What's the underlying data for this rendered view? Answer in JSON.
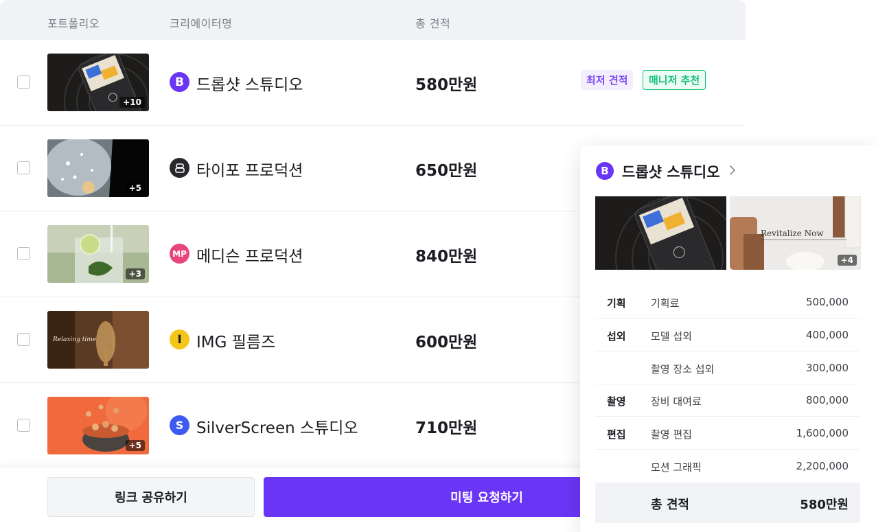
{
  "table": {
    "headers": {
      "portfolio": "포트폴리오",
      "creator": "크리에이터명",
      "total": "총 견적"
    },
    "rows": [
      {
        "creator": "드롭샷 스튜디오",
        "logo_text": "B",
        "logo_color": "#6a35f5",
        "price": "580만원",
        "thumb_count": "+10",
        "tags": {
          "lowest": "최저 견적",
          "recommend": "매니저 추천"
        }
      },
      {
        "creator": "타이포 프로덕션",
        "logo_text": "",
        "logo_color": "#26282c",
        "price": "650만원",
        "thumb_count": "+5"
      },
      {
        "creator": "메디슨 프로덕션",
        "logo_text": "MP",
        "logo_color": "#e8457c",
        "price": "840만원",
        "thumb_count": "+3"
      },
      {
        "creator": "IMG 필름즈",
        "logo_text": "I",
        "logo_color": "#f5c518",
        "price": "600만원",
        "thumb_count": "",
        "thumb_text": "Relaxing time"
      },
      {
        "creator": "SilverScreen 스튜디오",
        "logo_text": "S",
        "logo_color": "#3d5af1",
        "price": "710만원",
        "thumb_count": "+5"
      }
    ]
  },
  "actions": {
    "share_label": "링크 공유하기",
    "meeting_label": "미팅 요청하기"
  },
  "detail": {
    "logo_text": "B",
    "title": "드롭샷 스튜디오",
    "image_count": "+4",
    "image_text": "Revitalize Now",
    "costs": [
      {
        "category": "기획",
        "item": "기획료",
        "amount": "500,000"
      },
      {
        "category": "섭외",
        "item": "모델 섭외",
        "amount": "400,000"
      },
      {
        "category": "",
        "item": "촬영 장소 섭외",
        "amount": "300,000"
      },
      {
        "category": "촬영",
        "item": "장비 대여료",
        "amount": "800,000"
      },
      {
        "category": "편집",
        "item": "촬영 편집",
        "amount": "1,600,000"
      },
      {
        "category": "",
        "item": "모션 그래픽",
        "amount": "2,200,000"
      }
    ],
    "total_label": "총 견적",
    "total_value": "580만원"
  },
  "colors": {
    "accent": "#6a35f5",
    "recommend": "#13c178",
    "lowest_bg": "#f3eefe"
  }
}
